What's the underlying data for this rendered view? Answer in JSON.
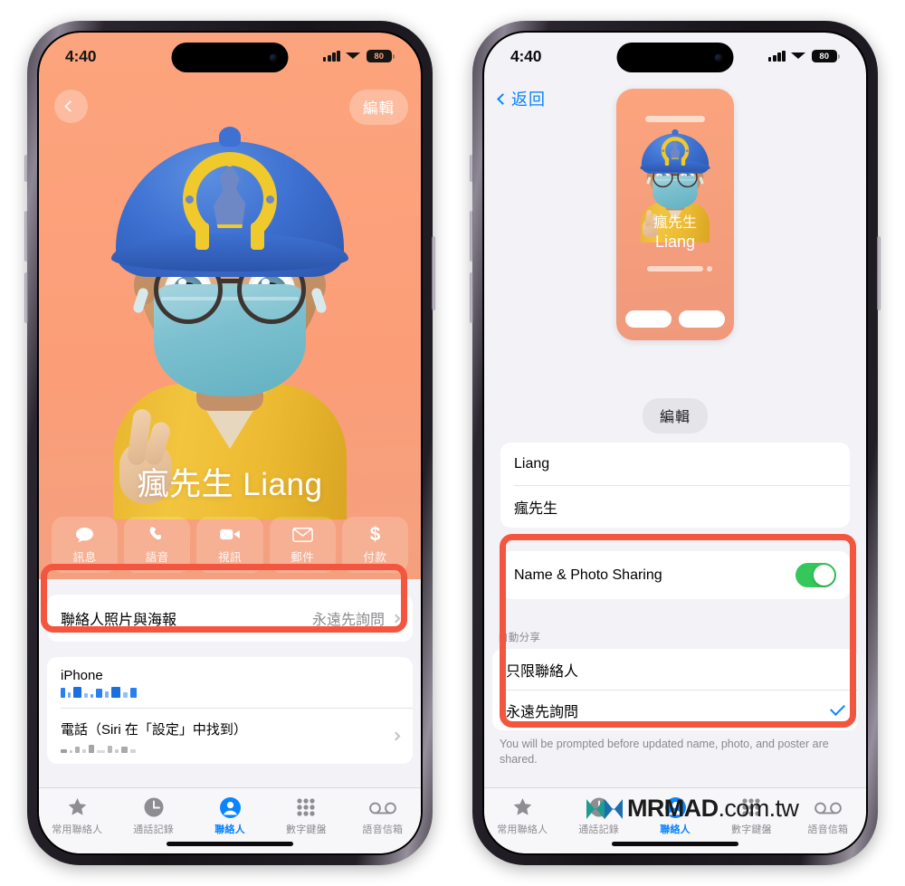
{
  "meta": {
    "platform": "iOS Phone app — Contacts",
    "watermark": {
      "logo_icon": "mrmad-logo-icon",
      "brand": "MRMAD",
      "domain": ".com.tw",
      "color": "#1f9d8c"
    }
  },
  "colors": {
    "ios_blue": "#0a84ff",
    "toggle_green": "#34c759",
    "annotation_red": "#f4553f",
    "poster_orange": "#fba47d",
    "list_bg": "#f2f2f7"
  },
  "status_bar": {
    "time": "4:40",
    "battery_percent": "80",
    "signal_icon": "cellular-signal-icon",
    "wifi_icon": "wifi-icon",
    "battery_icon": "battery-icon"
  },
  "left_phone": {
    "screen_name": "contact-detail",
    "nav": {
      "back_icon": "chevron-left-icon",
      "edit_label": "編輯"
    },
    "contact": {
      "full_name": "瘋先生 Liang",
      "first_name": "Liang",
      "last_name": "瘋先生",
      "avatar_icon": "memoji-avatar-icon"
    },
    "actions": [
      {
        "label": "訊息",
        "icon": "message-bubble-icon"
      },
      {
        "label": "語音",
        "icon": "phone-handset-icon"
      },
      {
        "label": "視訊",
        "icon": "video-camera-icon"
      },
      {
        "label": "郵件",
        "icon": "envelope-icon"
      },
      {
        "label": "付款",
        "icon": "dollar-sign-icon"
      }
    ],
    "sharing_row": {
      "title": "聯絡人照片與海報",
      "value": "永遠先詢問",
      "chevron_icon": "chevron-right-icon",
      "highlighted": true
    },
    "detail_rows": [
      {
        "label": "iPhone",
        "value_redacted": true,
        "value_style": "blue"
      },
      {
        "label": "電話（Siri 在「設定」中找到）",
        "value_redacted": true,
        "value_style": "gray",
        "chevron_icon": "chevron-right-icon"
      }
    ]
  },
  "right_phone": {
    "screen_name": "name-and-photo-sharing",
    "nav": {
      "back_icon": "chevron-left-icon",
      "back_label": "返回"
    },
    "poster_preview": {
      "name_line1": "瘋先生",
      "name_line2": "Liang",
      "avatar_icon": "memoji-avatar-icon"
    },
    "edit_button": "編輯",
    "name_fields": [
      {
        "name": "first-name-field",
        "value": "Liang"
      },
      {
        "name": "last-name-field",
        "value": "瘋先生"
      }
    ],
    "sharing_toggle": {
      "label": "Name & Photo Sharing",
      "enabled": true,
      "state_text": "On"
    },
    "auto_share": {
      "group_header": "自動分享",
      "options": [
        {
          "label": "只限聯絡人",
          "selected": false
        },
        {
          "label": "永遠先詢問",
          "selected": true,
          "check_icon": "checkmark-icon"
        }
      ]
    },
    "footnote": "You will be prompted before updated name, photo, and poster are shared.",
    "highlighted": true
  },
  "tab_bar": [
    {
      "label": "常用聯絡人",
      "icon": "star-icon",
      "active": false
    },
    {
      "label": "通話記錄",
      "icon": "clock-icon",
      "active": false
    },
    {
      "label": "聯絡人",
      "icon": "person-circle-icon",
      "active": true
    },
    {
      "label": "數字鍵盤",
      "icon": "keypad-dots-icon",
      "active": false
    },
    {
      "label": "語音信箱",
      "icon": "voicemail-icon",
      "active": false
    }
  ]
}
